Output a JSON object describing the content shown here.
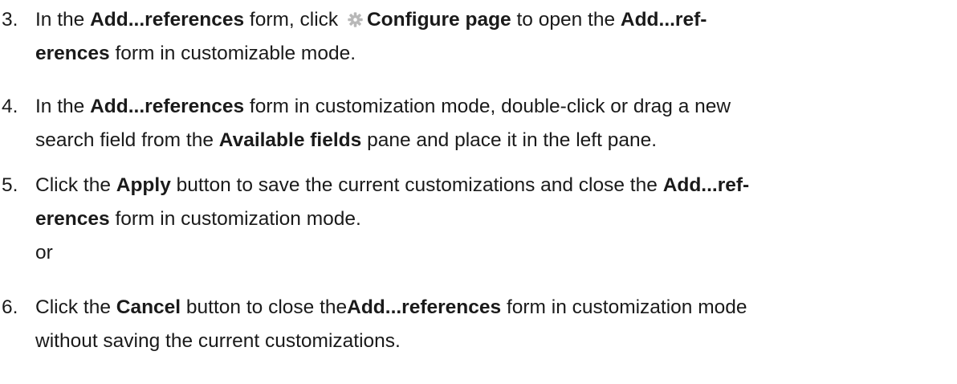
{
  "steps": [
    {
      "num": "3.",
      "l1_a": "In the ",
      "l1_b": "Add...references",
      "l1_c": " form, click ",
      "icon": "gear-icon",
      "l1_d": "Configure page",
      "l1_e": " to open the ",
      "l1_f": "Add...ref-",
      "l2_a": "erences",
      "l2_b": " form in customizable mode."
    },
    {
      "num": "4.",
      "l1_a": "In the ",
      "l1_b": "Add...references",
      "l1_c": " form in customization mode, double-click or drag a new",
      "l2_a": "search field from the ",
      "l2_b": "Available fields",
      "l2_c": " pane and place it in the left pane."
    },
    {
      "num": "5.",
      "l1_a": "Click the ",
      "l1_b": "Apply",
      "l1_c": " button to save the current customizations and close the ",
      "l1_d": "Add...ref-",
      "l2_a": "erences",
      "l2_b": " form in customization mode.",
      "l3": "or"
    },
    {
      "num": "6.",
      "l1_a": "Click the ",
      "l1_b": "Cancel",
      "l1_c": " button to close the",
      "l1_d": "Add...references",
      "l1_e": " form in customization mode",
      "l2": "without saving the current customizations."
    }
  ]
}
